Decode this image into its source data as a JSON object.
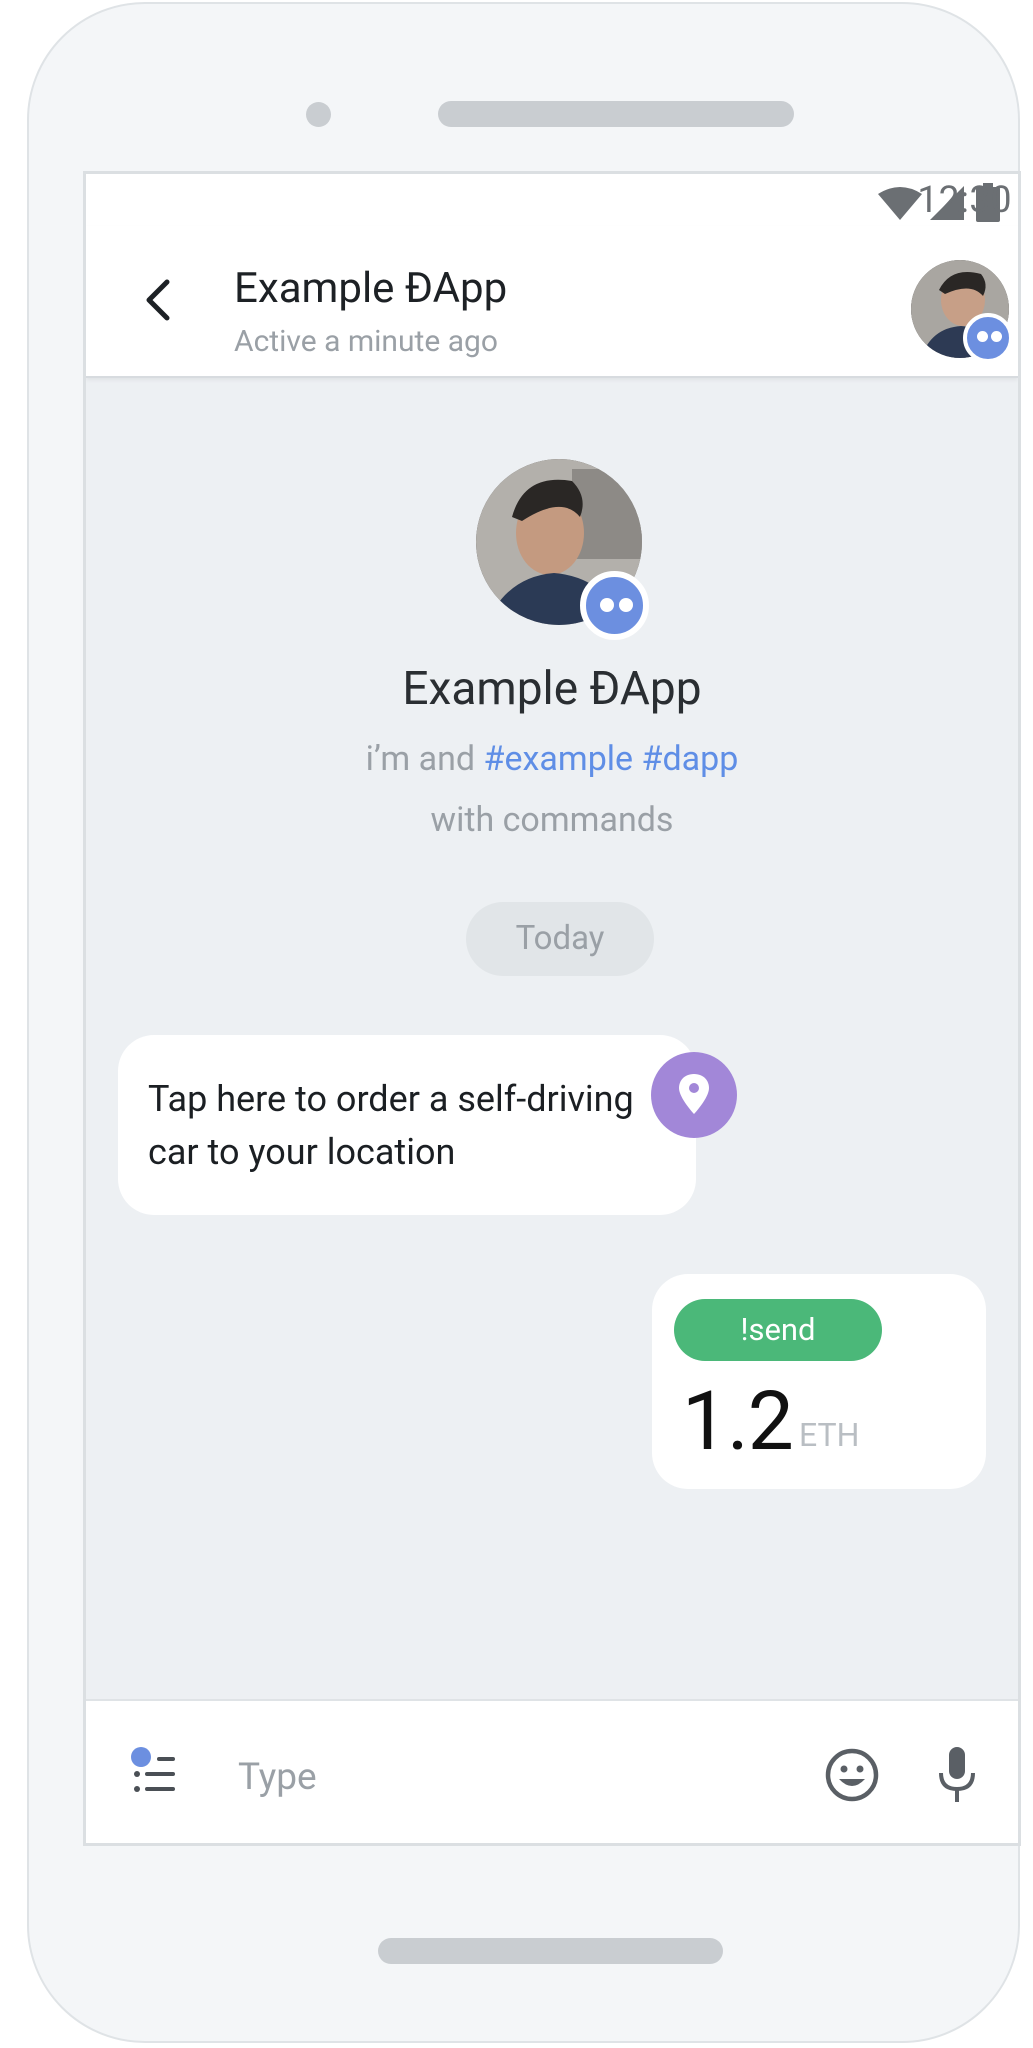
{
  "status_bar": {
    "time": "12:30",
    "icons": [
      "wifi-icon",
      "signal-icon",
      "battery-icon"
    ]
  },
  "header": {
    "title": "Example ĐApp",
    "subtitle": "Active a minute ago",
    "back_icon": "chevron-left-icon"
  },
  "profile": {
    "name": "Example ĐApp",
    "description_prefix": "i’m and ",
    "tags": "#example #dapp",
    "description_suffix": "with commands"
  },
  "date_divider": "Today",
  "messages": {
    "incoming": {
      "text": "Tap here to order a self-driving car to your location",
      "action_icon": "location-pin-icon"
    },
    "outgoing": {
      "command": "!send",
      "amount": "1.2",
      "unit": "ETH"
    }
  },
  "input": {
    "placeholder": "Type",
    "icons": [
      "commands-icon",
      "emoji-icon",
      "microphone-icon"
    ]
  },
  "colors": {
    "accent_blue": "#6c8fe0",
    "tag_blue": "#5f8ee6",
    "command_green": "#4bb879",
    "location_purple": "#a287d8",
    "chat_background": "#edf0f3"
  }
}
